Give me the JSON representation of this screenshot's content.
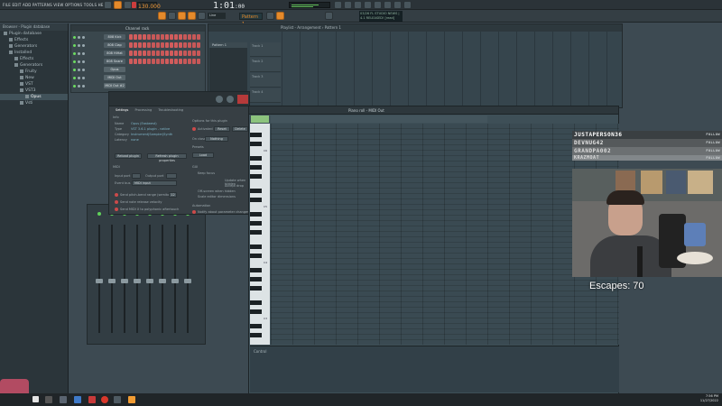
{
  "menubar": {
    "items": "FILE EDIT ADD PATTERNS VIEW OPTIONS TOOLS HELP"
  },
  "project": {
    "name": "Untitled",
    "time_small": "0:00:00"
  },
  "transport": {
    "bpm": "130.000",
    "song_time": "1:01",
    "song_time_small": ":00",
    "pattern": "Pattern 1",
    "mode": "Line"
  },
  "hint": {
    "line1": "03/26 FL STUDIO NEWS |",
    "line2": "4.1 RELEASED! [read]"
  },
  "browser": {
    "header": "Browser - Plugin database",
    "items": [
      "Plugin database",
      "Effects",
      "Generators",
      "Installed",
      "Effects",
      "Generators",
      "Fruity",
      "New",
      "VST",
      "VST3",
      "Opus",
      "Vsti"
    ]
  },
  "channel_rack": {
    "title": "Channel rack",
    "channels": [
      "808 Kick",
      "808 Clap",
      "808 HiHat",
      "808 Snare",
      "Opus",
      "MIDI Out",
      "MIDI Out #2"
    ]
  },
  "plugin": {
    "tabs": [
      "Settings",
      "Processing",
      "Troubleshooting"
    ],
    "info_label": "Info",
    "name_label": "Name",
    "name_value": "Opus (Eastwest)",
    "type_label": "Type",
    "type_value": "VST 3.6.1 plugin - native",
    "category_label": "Category",
    "category_value": "Instrument|Sampler|Synth",
    "latency_label": "Latency",
    "latency_value": "none",
    "reload_btn": "Reload plugin",
    "refresh_btn": "Refresh plugin properties",
    "midi_label": "MIDI",
    "input_port": "Input port",
    "output_port": "Output port",
    "event_label": "Event bus",
    "event_value": "MIDI input",
    "opt1": "Send pitch-bend range (semitones)",
    "opt2": "Send note release velocity",
    "opt3": "Send MIDI X to polyphonic aftertouch",
    "options_label": "Options for this plugin",
    "activated": "Activated",
    "reset": "Reset",
    "delete": "Delete",
    "on_close": "On close",
    "on_close_value": "Nothing",
    "presets_label": "Presets",
    "load_btn": "Load",
    "gui_label": "GUI",
    "gui1": "Keep focus",
    "gui2": "Update when hidden",
    "gui3": "Accept drop",
    "gui4": "Off-screen when hidden",
    "gui5": "Scale editor dimensions",
    "automation_label": "Automation",
    "auto1": "Notify about parameter changes",
    "pb_range": "12"
  },
  "playlist": {
    "title": "Playlist - Arrangement › Pattern 1",
    "pattern_item": "Pattern 1",
    "tracks": [
      "Track 1",
      "Track 2",
      "Track 3",
      "Track 4"
    ]
  },
  "piano_roll": {
    "title": "Piano roll - MIDI Out",
    "control_label": "Control",
    "key_labels": [
      "C6",
      "C5",
      "C4",
      "C3"
    ]
  },
  "overlay": {
    "chat": [
      {
        "name": "JUSTAPERSON36",
        "tag": "FOLLOW"
      },
      {
        "name": "DEVNUG42",
        "tag": "FOLLOW"
      },
      {
        "name": "GRANDPA002",
        "tag": "FOLLOW"
      },
      {
        "name": "KRAZMOAT",
        "tag": "FOLLOW"
      }
    ],
    "escapes_text": "Escapes: 70"
  },
  "taskbar": {
    "time": "7:56 PM",
    "date": "11/27/2022"
  }
}
